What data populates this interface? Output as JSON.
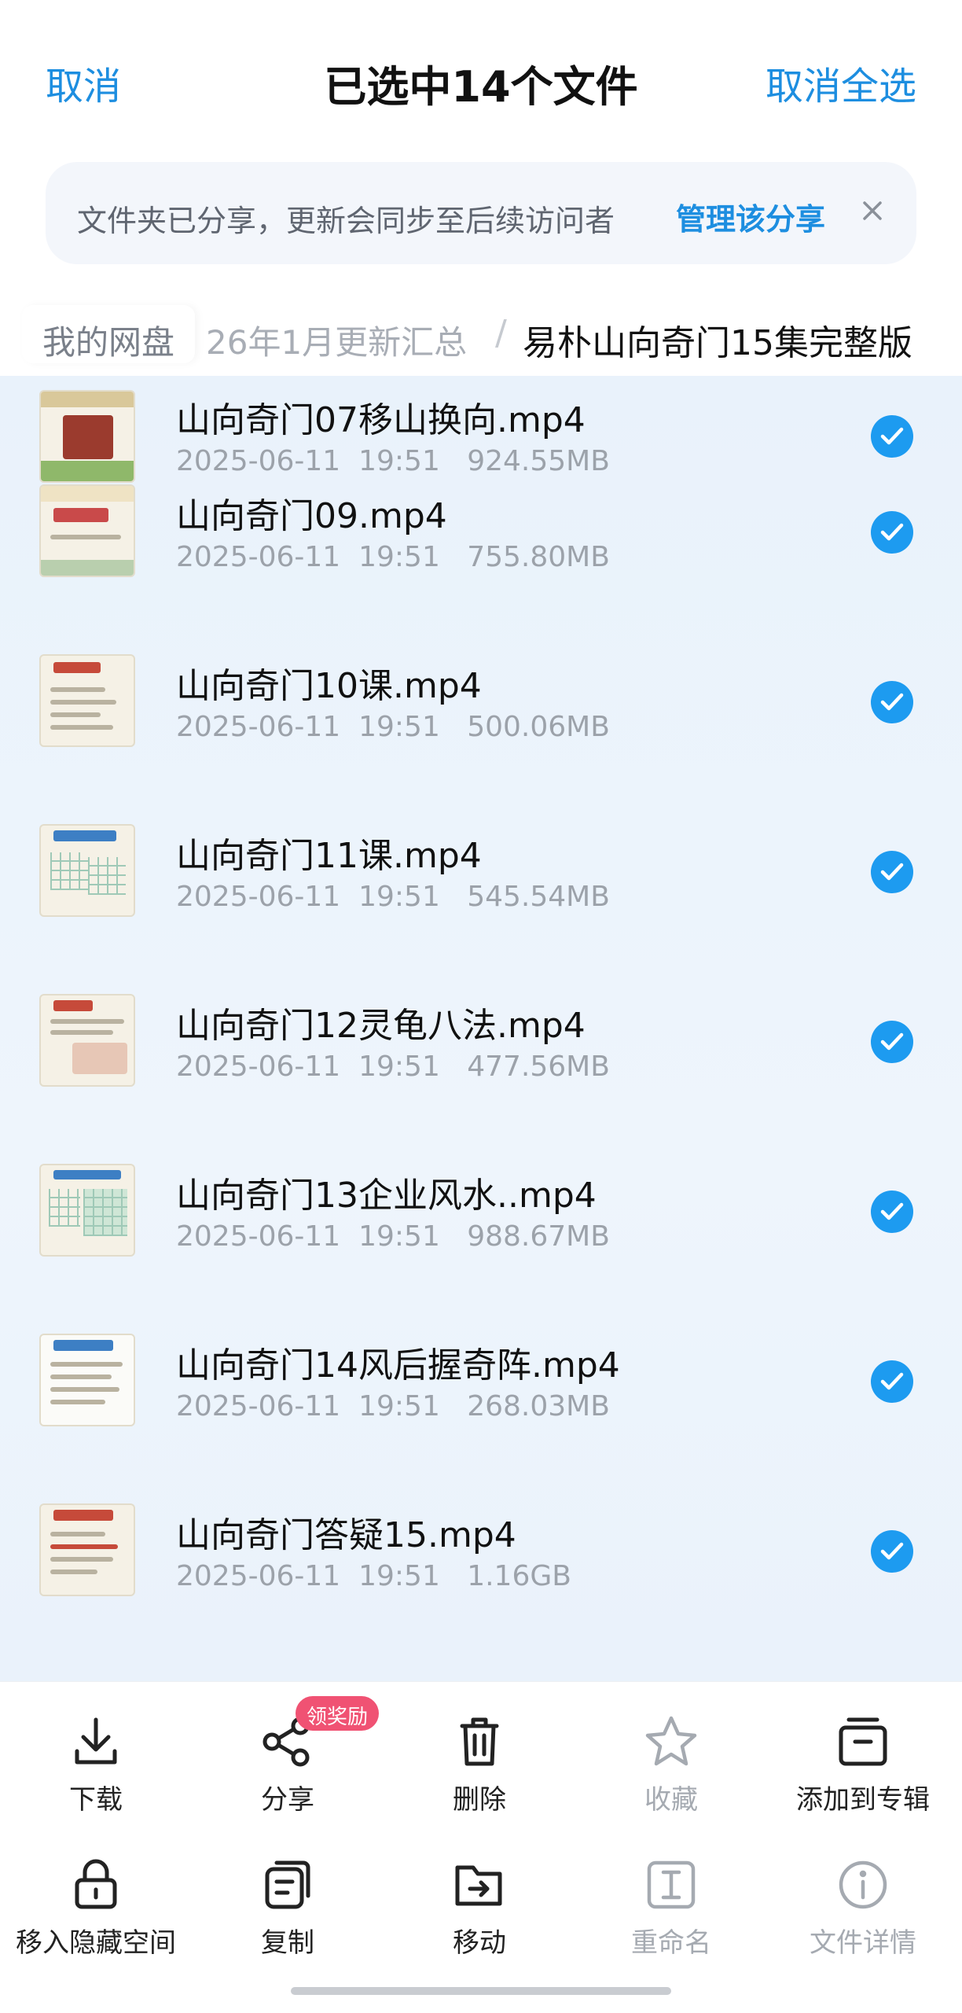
{
  "header": {
    "cancel": "取消",
    "title": "已选中14个文件",
    "deselect_all": "取消全选"
  },
  "share_banner": {
    "text": "文件夹已分享，更新会同步至后续访问者",
    "link": "管理该分享"
  },
  "breadcrumb": {
    "root": "我的网盘",
    "middle": "26年1月更新汇总",
    "separator": "/",
    "current": "易朴山向奇门15集完整版"
  },
  "files": [
    {
      "name": "山向奇门07移山换向.mp4",
      "date": "2025-06-11",
      "time": "19:51",
      "size": "924.55MB",
      "selected": true
    },
    {
      "name": "山向奇门09.mp4",
      "date": "2025-06-11",
      "time": "19:51",
      "size": "755.80MB",
      "selected": true
    },
    {
      "name": "山向奇门10课.mp4",
      "date": "2025-06-11",
      "time": "19:51",
      "size": "500.06MB",
      "selected": true
    },
    {
      "name": "山向奇门11课.mp4",
      "date": "2025-06-11",
      "time": "19:51",
      "size": "545.54MB",
      "selected": true
    },
    {
      "name": "山向奇门12灵龟八法.mp4",
      "date": "2025-06-11",
      "time": "19:51",
      "size": "477.56MB",
      "selected": true
    },
    {
      "name": "山向奇门13企业风水..mp4",
      "date": "2025-06-11",
      "time": "19:51",
      "size": "988.67MB",
      "selected": true
    },
    {
      "name": "山向奇门14风后握奇阵.mp4",
      "date": "2025-06-11",
      "time": "19:51",
      "size": "268.03MB",
      "selected": true
    },
    {
      "name": "山向奇门答疑15.mp4",
      "date": "2025-06-11",
      "time": "19:51",
      "size": "1.16GB",
      "selected": true
    }
  ],
  "actions_row1": [
    {
      "label": "下载",
      "icon": "download-icon",
      "enabled": true
    },
    {
      "label": "分享",
      "icon": "share-icon",
      "enabled": true,
      "badge": "领奖励"
    },
    {
      "label": "删除",
      "icon": "trash-icon",
      "enabled": true
    },
    {
      "label": "收藏",
      "icon": "star-icon",
      "enabled": false
    },
    {
      "label": "添加到专辑",
      "icon": "album-icon",
      "enabled": true
    }
  ],
  "actions_row2": [
    {
      "label": "移入隐藏空间",
      "icon": "lock-icon",
      "enabled": true
    },
    {
      "label": "复制",
      "icon": "copy-icon",
      "enabled": true
    },
    {
      "label": "移动",
      "icon": "move-icon",
      "enabled": true
    },
    {
      "label": "重命名",
      "icon": "rename-icon",
      "enabled": false
    },
    {
      "label": "文件详情",
      "icon": "info-icon",
      "enabled": false
    }
  ],
  "colors": {
    "accent": "#1d8ee0",
    "check": "#1d9bf0",
    "badge": "#f05273",
    "list_bg": "#eaf2fb"
  }
}
